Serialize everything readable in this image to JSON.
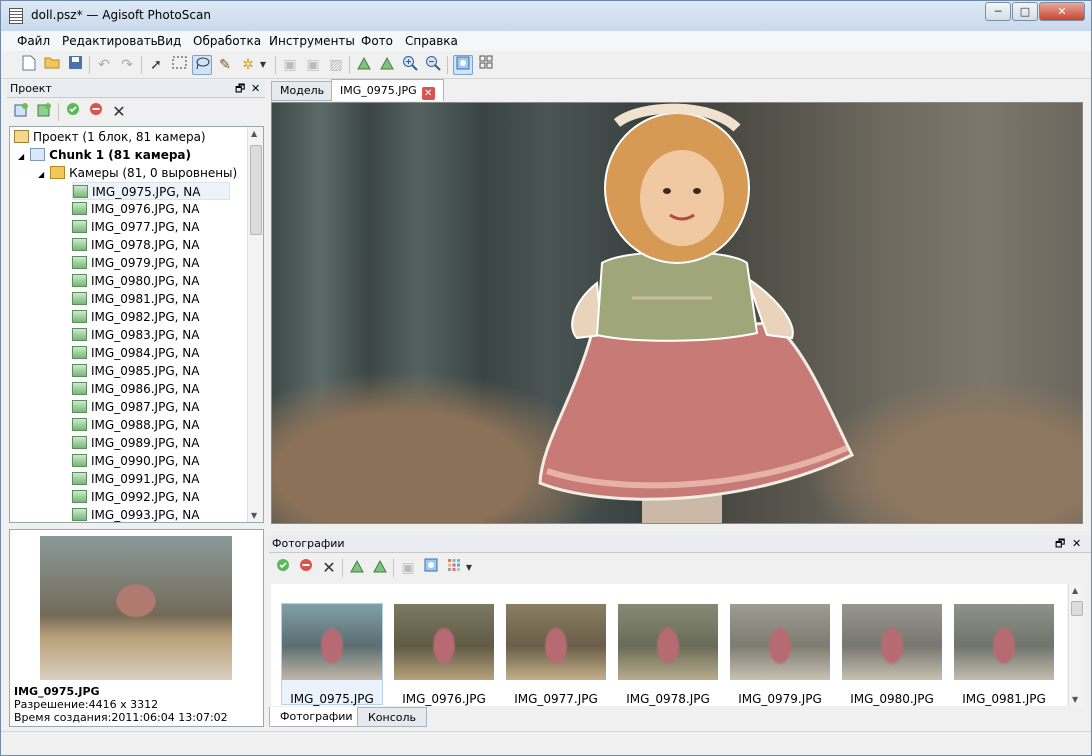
{
  "window": {
    "title": "doll.psz* — Agisoft PhotoScan",
    "controls": {
      "minimize": "─",
      "maximize": "□",
      "close": "✕"
    }
  },
  "menu": [
    "Файл",
    "Редактировать",
    "Вид",
    "Обработка",
    "Инструменты",
    "Фото",
    "Справка"
  ],
  "toolbar": {
    "icons": [
      "new-file-icon",
      "open-folder-icon",
      "save-icon",
      "undo-icon",
      "redo-icon",
      "pointer-icon",
      "rect-select-icon",
      "lasso-icon",
      "intelligent-scissors-icon",
      "magic-wand-icon",
      "dropdown-arrow-icon",
      "copy-mask-icon",
      "paste-mask-icon",
      "remove-mask-icon",
      "rotate-left-icon",
      "rotate-right-icon",
      "zoom-in-icon",
      "zoom-out-icon",
      "show-masks-icon",
      "grid-icon"
    ]
  },
  "project_panel": {
    "title": "Проект",
    "tree": {
      "root": "Проект (1 блок, 81 камера)",
      "chunk": "Chunk 1 (81 камера)",
      "cameras_folder": "Камеры (81, 0 выровнены)",
      "cameras": [
        "IMG_0975.JPG, NA",
        "IMG_0976.JPG, NA",
        "IMG_0977.JPG, NA",
        "IMG_0978.JPG, NA",
        "IMG_0979.JPG, NA",
        "IMG_0980.JPG, NA",
        "IMG_0981.JPG, NA",
        "IMG_0982.JPG, NA",
        "IMG_0983.JPG, NA",
        "IMG_0984.JPG, NA",
        "IMG_0985.JPG, NA",
        "IMG_0986.JPG, NA",
        "IMG_0987.JPG, NA",
        "IMG_0988.JPG, NA",
        "IMG_0989.JPG, NA",
        "IMG_0990.JPG, NA",
        "IMG_0991.JPG, NA",
        "IMG_0992.JPG, NA",
        "IMG_0993.JPG, NA"
      ]
    }
  },
  "preview": {
    "filename": "IMG_0975.JPG",
    "resolution": "Разрешение:4416 x 3312",
    "created": "Время создания:2011:06:04 13:07:02"
  },
  "tabs": [
    {
      "label": "Модель"
    },
    {
      "label": "IMG_0975.JPG"
    }
  ],
  "photos_panel": {
    "title": "Фотографии",
    "thumbnails": [
      "IMG_0975.JPG",
      "IMG_0976.JPG",
      "IMG_0977.JPG",
      "IMG_0978.JPG",
      "IMG_0979.JPG",
      "IMG_0980.JPG",
      "IMG_0981.JPG"
    ]
  },
  "bottom_tabs": [
    "Фотографии",
    "Консоль"
  ]
}
